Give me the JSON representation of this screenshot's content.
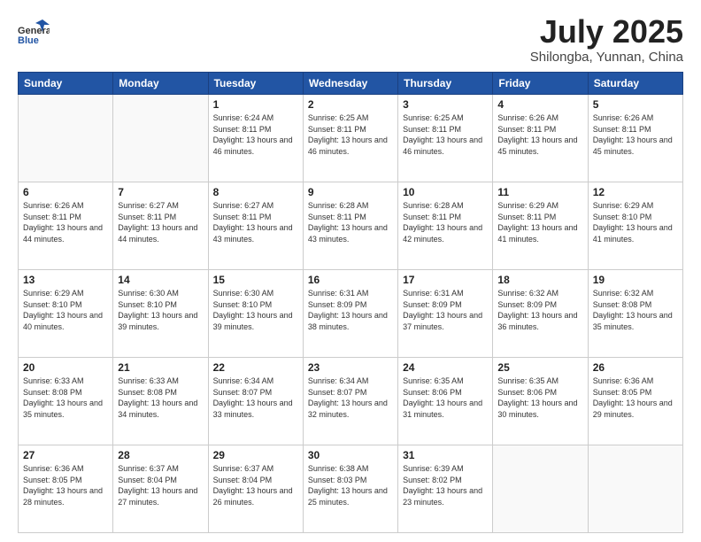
{
  "header": {
    "logo_general": "General",
    "logo_blue": "Blue",
    "title": "July 2025",
    "location": "Shilongba, Yunnan, China"
  },
  "weekdays": [
    "Sunday",
    "Monday",
    "Tuesday",
    "Wednesday",
    "Thursday",
    "Friday",
    "Saturday"
  ],
  "weeks": [
    [
      {
        "day": "",
        "info": ""
      },
      {
        "day": "",
        "info": ""
      },
      {
        "day": "1",
        "info": "Sunrise: 6:24 AM\nSunset: 8:11 PM\nDaylight: 13 hours and 46 minutes."
      },
      {
        "day": "2",
        "info": "Sunrise: 6:25 AM\nSunset: 8:11 PM\nDaylight: 13 hours and 46 minutes."
      },
      {
        "day": "3",
        "info": "Sunrise: 6:25 AM\nSunset: 8:11 PM\nDaylight: 13 hours and 46 minutes."
      },
      {
        "day": "4",
        "info": "Sunrise: 6:26 AM\nSunset: 8:11 PM\nDaylight: 13 hours and 45 minutes."
      },
      {
        "day": "5",
        "info": "Sunrise: 6:26 AM\nSunset: 8:11 PM\nDaylight: 13 hours and 45 minutes."
      }
    ],
    [
      {
        "day": "6",
        "info": "Sunrise: 6:26 AM\nSunset: 8:11 PM\nDaylight: 13 hours and 44 minutes."
      },
      {
        "day": "7",
        "info": "Sunrise: 6:27 AM\nSunset: 8:11 PM\nDaylight: 13 hours and 44 minutes."
      },
      {
        "day": "8",
        "info": "Sunrise: 6:27 AM\nSunset: 8:11 PM\nDaylight: 13 hours and 43 minutes."
      },
      {
        "day": "9",
        "info": "Sunrise: 6:28 AM\nSunset: 8:11 PM\nDaylight: 13 hours and 43 minutes."
      },
      {
        "day": "10",
        "info": "Sunrise: 6:28 AM\nSunset: 8:11 PM\nDaylight: 13 hours and 42 minutes."
      },
      {
        "day": "11",
        "info": "Sunrise: 6:29 AM\nSunset: 8:11 PM\nDaylight: 13 hours and 41 minutes."
      },
      {
        "day": "12",
        "info": "Sunrise: 6:29 AM\nSunset: 8:10 PM\nDaylight: 13 hours and 41 minutes."
      }
    ],
    [
      {
        "day": "13",
        "info": "Sunrise: 6:29 AM\nSunset: 8:10 PM\nDaylight: 13 hours and 40 minutes."
      },
      {
        "day": "14",
        "info": "Sunrise: 6:30 AM\nSunset: 8:10 PM\nDaylight: 13 hours and 39 minutes."
      },
      {
        "day": "15",
        "info": "Sunrise: 6:30 AM\nSunset: 8:10 PM\nDaylight: 13 hours and 39 minutes."
      },
      {
        "day": "16",
        "info": "Sunrise: 6:31 AM\nSunset: 8:09 PM\nDaylight: 13 hours and 38 minutes."
      },
      {
        "day": "17",
        "info": "Sunrise: 6:31 AM\nSunset: 8:09 PM\nDaylight: 13 hours and 37 minutes."
      },
      {
        "day": "18",
        "info": "Sunrise: 6:32 AM\nSunset: 8:09 PM\nDaylight: 13 hours and 36 minutes."
      },
      {
        "day": "19",
        "info": "Sunrise: 6:32 AM\nSunset: 8:08 PM\nDaylight: 13 hours and 35 minutes."
      }
    ],
    [
      {
        "day": "20",
        "info": "Sunrise: 6:33 AM\nSunset: 8:08 PM\nDaylight: 13 hours and 35 minutes."
      },
      {
        "day": "21",
        "info": "Sunrise: 6:33 AM\nSunset: 8:08 PM\nDaylight: 13 hours and 34 minutes."
      },
      {
        "day": "22",
        "info": "Sunrise: 6:34 AM\nSunset: 8:07 PM\nDaylight: 13 hours and 33 minutes."
      },
      {
        "day": "23",
        "info": "Sunrise: 6:34 AM\nSunset: 8:07 PM\nDaylight: 13 hours and 32 minutes."
      },
      {
        "day": "24",
        "info": "Sunrise: 6:35 AM\nSunset: 8:06 PM\nDaylight: 13 hours and 31 minutes."
      },
      {
        "day": "25",
        "info": "Sunrise: 6:35 AM\nSunset: 8:06 PM\nDaylight: 13 hours and 30 minutes."
      },
      {
        "day": "26",
        "info": "Sunrise: 6:36 AM\nSunset: 8:05 PM\nDaylight: 13 hours and 29 minutes."
      }
    ],
    [
      {
        "day": "27",
        "info": "Sunrise: 6:36 AM\nSunset: 8:05 PM\nDaylight: 13 hours and 28 minutes."
      },
      {
        "day": "28",
        "info": "Sunrise: 6:37 AM\nSunset: 8:04 PM\nDaylight: 13 hours and 27 minutes."
      },
      {
        "day": "29",
        "info": "Sunrise: 6:37 AM\nSunset: 8:04 PM\nDaylight: 13 hours and 26 minutes."
      },
      {
        "day": "30",
        "info": "Sunrise: 6:38 AM\nSunset: 8:03 PM\nDaylight: 13 hours and 25 minutes."
      },
      {
        "day": "31",
        "info": "Sunrise: 6:39 AM\nSunset: 8:02 PM\nDaylight: 13 hours and 23 minutes."
      },
      {
        "day": "",
        "info": ""
      },
      {
        "day": "",
        "info": ""
      }
    ]
  ]
}
